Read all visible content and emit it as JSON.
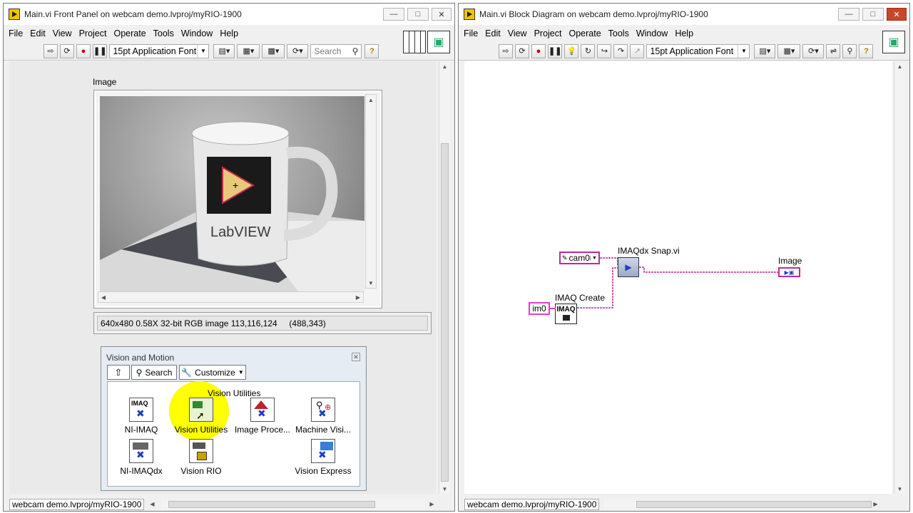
{
  "front_panel": {
    "title": "Main.vi Front Panel on webcam demo.lvproj/myRIO-1900",
    "menu": [
      "File",
      "Edit",
      "View",
      "Project",
      "Operate",
      "Tools",
      "Window",
      "Help"
    ],
    "font": "15pt Application Font",
    "search_placeholder": "Search",
    "image_label": "Image",
    "image_status": "640x480 0.58X 32-bit RGB image 113,116,124     (488,343)",
    "mug_text": "LabVIEW",
    "status_target": "webcam demo.lvproj/myRIO-1900"
  },
  "palette": {
    "title": "Vision and Motion",
    "search_label": "Search",
    "customize_label": "Customize",
    "tooltip": "Vision Utilities",
    "items": [
      {
        "label": "NI-IMAQ",
        "icon_text": "IMAQ"
      },
      {
        "label": "Vision Utilities",
        "icon_text": ""
      },
      {
        "label": "Image Proce...",
        "icon_text": ""
      },
      {
        "label": "Machine Visi...",
        "icon_text": ""
      },
      {
        "label": "NI-IMAQdx",
        "icon_text": ""
      },
      {
        "label": "Vision RIO",
        "icon_text": ""
      },
      {
        "label": "Vision Express",
        "icon_text": ""
      }
    ]
  },
  "block_diagram": {
    "title": "Main.vi Block Diagram on webcam demo.lvproj/myRIO-1900",
    "menu": [
      "File",
      "Edit",
      "View",
      "Project",
      "Operate",
      "Tools",
      "Window",
      "Help"
    ],
    "font": "15pt Application Font",
    "camera_constant": "cam0",
    "image_name_constant": "im0",
    "snap_label": "IMAQdx Snap.vi",
    "create_label": "IMAQ Create",
    "create_icon_text": "IMAQ",
    "indicator_label": "Image",
    "status_target": "webcam demo.lvproj/myRIO-1900"
  },
  "colors": {
    "image_wire": "#c02a9a",
    "highlight": "#ffff00"
  }
}
